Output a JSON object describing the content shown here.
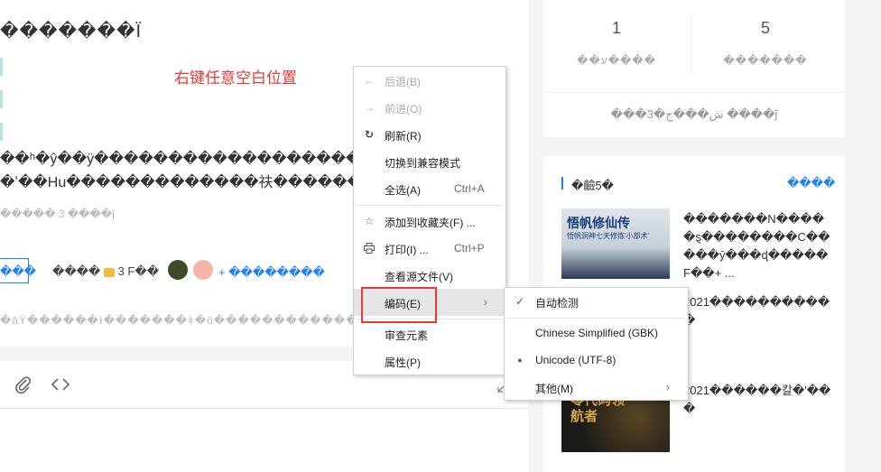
{
  "article": {
    "title_garbled": "�������Ï",
    "para1_garbled": "��ʰ�ŷ��ÿ�������������������ʾ",
    "para2_garbled": "�ʽ��Hu�������������䃿��������",
    "meta_garbled": "����� 3 ����ĵ",
    "follow_btn": "���",
    "coin_text": "����",
    "coin_count": "3 F��",
    "more_link": "+ ��������",
    "footer_garbled": "�ăŸ������ɫ�������ǂ�ō�������������йǿυ�����"
  },
  "annotation": "右键任意空白位置",
  "sidebar": {
    "stats": [
      {
        "value": "1",
        "label": "��ע����"
      },
      {
        "value": "5",
        "label": "�������"
      }
    ],
    "stats_footer": "���3�ش���ج ����ǰ",
    "recent_header": "�䶨5�",
    "recent_more": "����",
    "items": [
      {
        "title": "�������N�����ȿ��������C�����ӯ���ɖ�����F��+ ...",
        "thumb_title": "悟帆修仙传",
        "thumb_subtitle": "悟帆洞神七天修炼'小部术'"
      },
      {
        "title": "2021�����������",
        "thumb_title": "",
        "thumb_subtitle": ""
      },
      {
        "title": "2021������칼�'���",
        "thumb_title": "零代码领航者",
        "thumb_subtitle": ""
      }
    ]
  },
  "context_menu": {
    "items": [
      {
        "label": "后退(B)",
        "icon": "back-arrow-icon",
        "enabled": false
      },
      {
        "label": "前进(O)",
        "icon": "forward-arrow-icon",
        "enabled": false
      },
      {
        "label": "刷新(R)",
        "icon": "refresh-icon",
        "enabled": true
      },
      {
        "label": "切换到兼容模式",
        "enabled": true
      },
      {
        "label": "全选(A)",
        "shortcut": "Ctrl+A",
        "enabled": true
      },
      {
        "label": "添加到收藏夹(F) ...",
        "icon": "star-icon",
        "enabled": true
      },
      {
        "label": "打印(I) ...",
        "icon": "printer-icon",
        "shortcut": "Ctrl+P",
        "enabled": true
      },
      {
        "label": "查看源文件(V)",
        "enabled": true
      },
      {
        "label": "编码(E)",
        "enabled": true,
        "submenu": true
      },
      {
        "label": "审查元素",
        "enabled": true
      },
      {
        "label": "属性(P)",
        "enabled": true
      }
    ],
    "encoding_submenu": [
      {
        "label": "自动检测",
        "checked": true
      },
      {
        "label": "Chinese Simplified (GBK)"
      },
      {
        "label": "Unicode (UTF-8)",
        "selected": true
      },
      {
        "label": "其他(M)",
        "submenu": true
      }
    ]
  },
  "colors": {
    "accent": "#1e80ff",
    "annotation_red": "#e53935",
    "menu_highlight": "#e5e5e5"
  }
}
